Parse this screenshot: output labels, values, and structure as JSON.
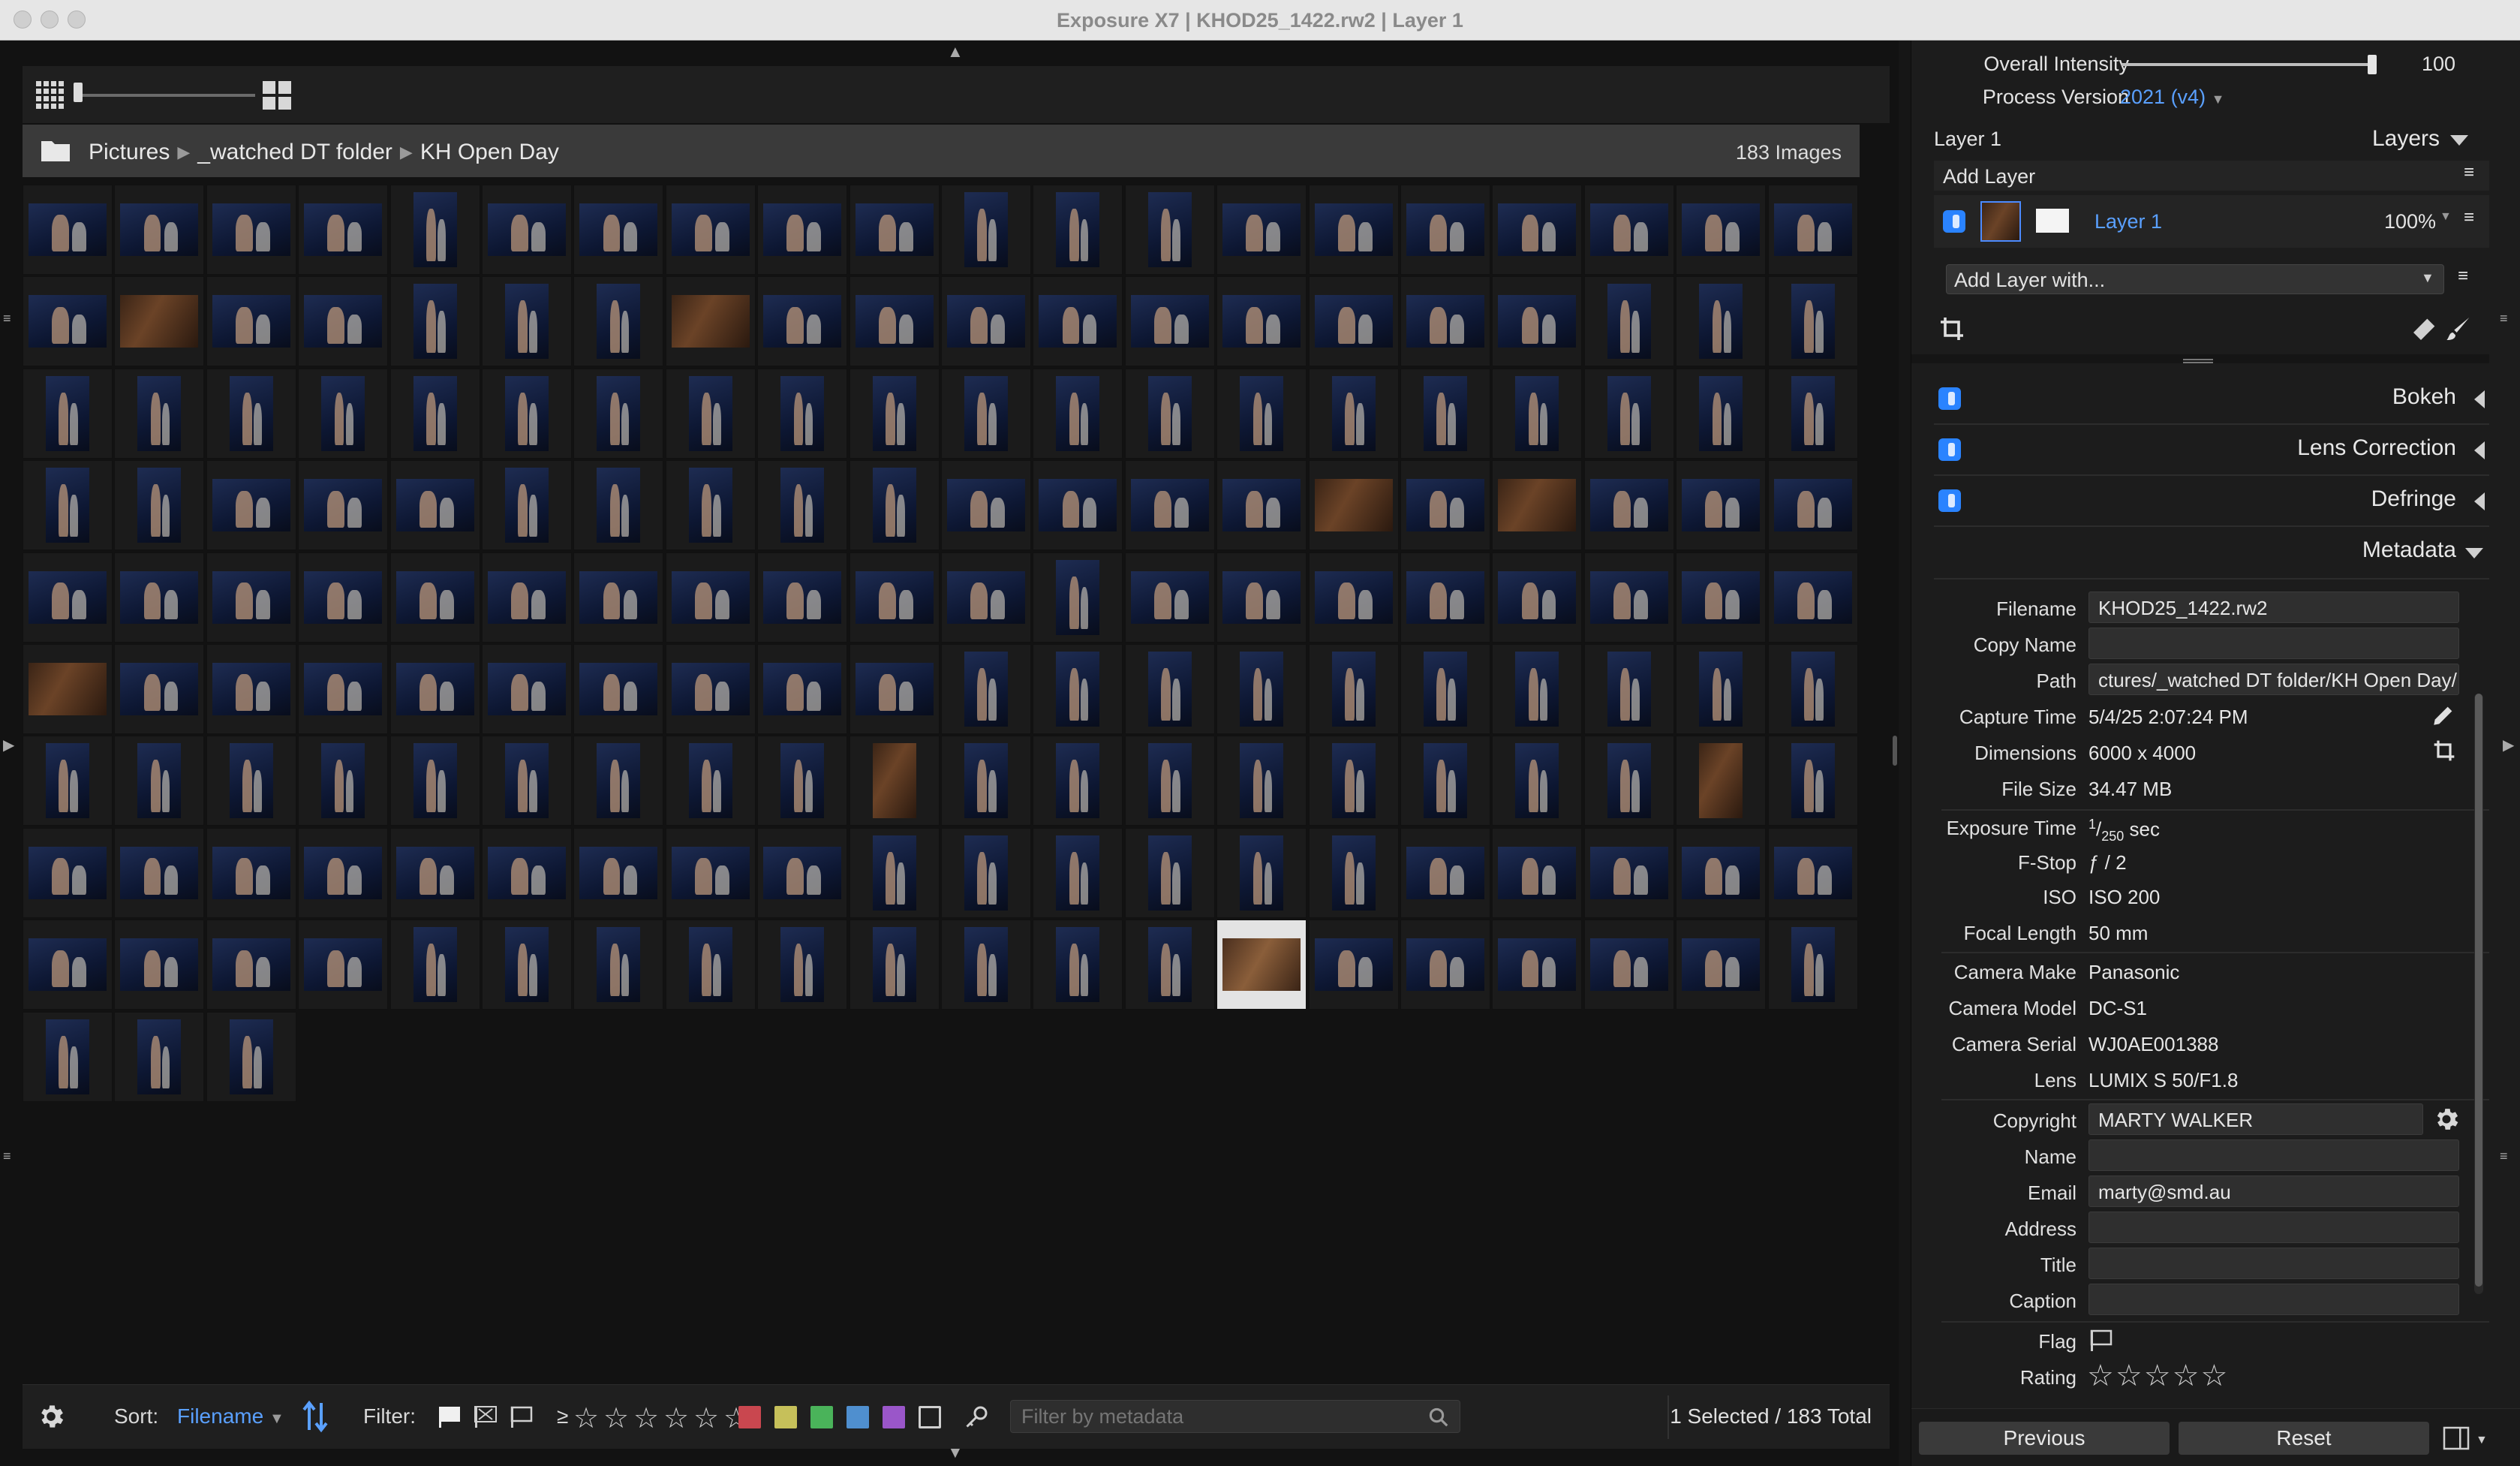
{
  "window": {
    "title": "Exposure X7 | KHOD25_1422.rw2 | Layer 1"
  },
  "browser": {
    "breadcrumb": [
      "Pictures",
      "_watched DT folder",
      "KH Open Day"
    ],
    "image_count": "183 Images"
  },
  "bottom_bar": {
    "sort_label": "Sort:",
    "sort_value": "Filename",
    "filter_label": "Filter:",
    "rating_prefix": "≥",
    "color_labels": [
      "#c9474f",
      "#c6c05a",
      "#4ab35a",
      "#4f8fcf",
      "#9a56c9"
    ],
    "filter_placeholder": "Filter by metadata",
    "selection_status": "1 Selected / 183 Total"
  },
  "panel": {
    "overall_intensity_label": "Overall Intensity",
    "overall_intensity_value": "100",
    "overall_intensity_level": 1.0,
    "process_version_label": "Process Version",
    "process_version_value": "2021 (v4)",
    "layer_name_header": "Layer 1",
    "layers_label": "Layers",
    "add_layer_label": "Add Layer",
    "layer_item_name": "Layer 1",
    "layer_item_opacity": "100%",
    "add_layer_with": "Add Layer with...",
    "sections": [
      "Bokeh",
      "Lens Correction",
      "Defringe"
    ],
    "metadata_title": "Metadata",
    "metadata": {
      "filename_label": "Filename",
      "filename": "KHOD25_1422.rw2",
      "copy_name_label": "Copy Name",
      "copy_name": "",
      "path_label": "Path",
      "path": "ctures/_watched DT folder/KH Open Day/",
      "capture_time_label": "Capture Time",
      "capture_time": "5/4/25 2:07:24 PM",
      "dimensions_label": "Dimensions",
      "dimensions": "6000 x 4000",
      "file_size_label": "File Size",
      "file_size": "34.47 MB",
      "exposure_time_label": "Exposure Time",
      "exposure_time_num": "1",
      "exposure_time_den": "250",
      "exposure_time_unit": "sec",
      "fstop_label": "F-Stop",
      "fstop": "ƒ / 2",
      "iso_label": "ISO",
      "iso": "ISO 200",
      "focal_length_label": "Focal Length",
      "focal_length": "50 mm",
      "camera_make_label": "Camera Make",
      "camera_make": "Panasonic",
      "camera_model_label": "Camera Model",
      "camera_model": "DC-S1",
      "camera_serial_label": "Camera Serial",
      "camera_serial": "WJ0AE001388",
      "lens_label": "Lens",
      "lens": "LUMIX S 50/F1.8",
      "copyright_label": "Copyright",
      "copyright": "MARTY WALKER",
      "name_label": "Name",
      "name": "",
      "email_label": "Email",
      "email": "marty@smd.au",
      "address_label": "Address",
      "address": "",
      "title_label": "Title",
      "title": "",
      "caption_label": "Caption",
      "caption": "",
      "flag_label": "Flag",
      "rating_label": "Rating"
    },
    "previous_button": "Previous",
    "reset_button": "Reset"
  },
  "colors": {
    "accent": "#5aa0ff",
    "toggle": "#2a83ff"
  }
}
